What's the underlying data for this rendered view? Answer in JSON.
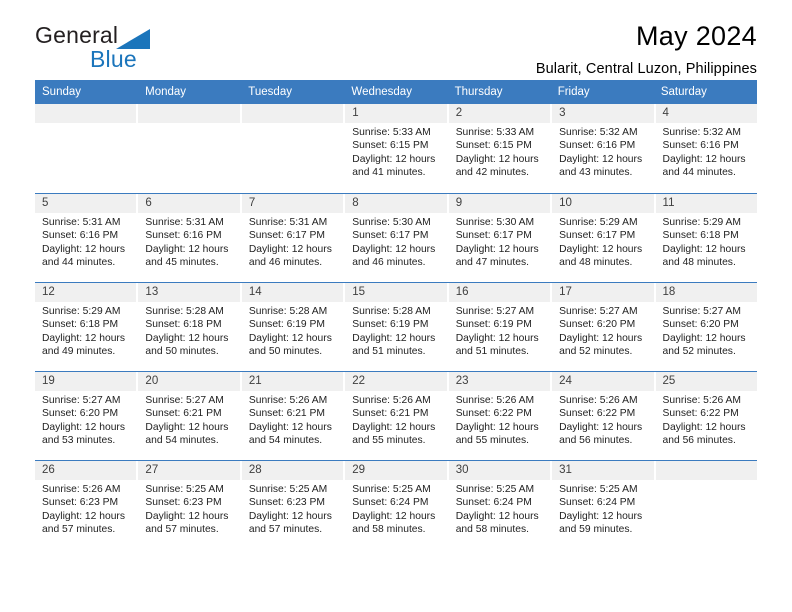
{
  "brand": {
    "name_part1": "General",
    "name_part2": "Blue",
    "triangle_color": "#1b75bb"
  },
  "header": {
    "title": "May 2024",
    "subtitle": "Bularit, Central Luzon, Philippines"
  },
  "theme": {
    "header_blue": "#3b7bbf",
    "daynum_gray": "#f0f0f0"
  },
  "calendar": {
    "weekdays": [
      "Sunday",
      "Monday",
      "Tuesday",
      "Wednesday",
      "Thursday",
      "Friday",
      "Saturday"
    ],
    "weeks": [
      [
        {
          "day": "",
          "empty": true
        },
        {
          "day": "",
          "empty": true
        },
        {
          "day": "",
          "empty": true
        },
        {
          "day": "1",
          "sunrise": "Sunrise: 5:33 AM",
          "sunset": "Sunset: 6:15 PM",
          "daylight": "Daylight: 12 hours and 41 minutes."
        },
        {
          "day": "2",
          "sunrise": "Sunrise: 5:33 AM",
          "sunset": "Sunset: 6:15 PM",
          "daylight": "Daylight: 12 hours and 42 minutes."
        },
        {
          "day": "3",
          "sunrise": "Sunrise: 5:32 AM",
          "sunset": "Sunset: 6:16 PM",
          "daylight": "Daylight: 12 hours and 43 minutes."
        },
        {
          "day": "4",
          "sunrise": "Sunrise: 5:32 AM",
          "sunset": "Sunset: 6:16 PM",
          "daylight": "Daylight: 12 hours and 44 minutes."
        }
      ],
      [
        {
          "day": "5",
          "sunrise": "Sunrise: 5:31 AM",
          "sunset": "Sunset: 6:16 PM",
          "daylight": "Daylight: 12 hours and 44 minutes."
        },
        {
          "day": "6",
          "sunrise": "Sunrise: 5:31 AM",
          "sunset": "Sunset: 6:16 PM",
          "daylight": "Daylight: 12 hours and 45 minutes."
        },
        {
          "day": "7",
          "sunrise": "Sunrise: 5:31 AM",
          "sunset": "Sunset: 6:17 PM",
          "daylight": "Daylight: 12 hours and 46 minutes."
        },
        {
          "day": "8",
          "sunrise": "Sunrise: 5:30 AM",
          "sunset": "Sunset: 6:17 PM",
          "daylight": "Daylight: 12 hours and 46 minutes."
        },
        {
          "day": "9",
          "sunrise": "Sunrise: 5:30 AM",
          "sunset": "Sunset: 6:17 PM",
          "daylight": "Daylight: 12 hours and 47 minutes."
        },
        {
          "day": "10",
          "sunrise": "Sunrise: 5:29 AM",
          "sunset": "Sunset: 6:17 PM",
          "daylight": "Daylight: 12 hours and 48 minutes."
        },
        {
          "day": "11",
          "sunrise": "Sunrise: 5:29 AM",
          "sunset": "Sunset: 6:18 PM",
          "daylight": "Daylight: 12 hours and 48 minutes."
        }
      ],
      [
        {
          "day": "12",
          "sunrise": "Sunrise: 5:29 AM",
          "sunset": "Sunset: 6:18 PM",
          "daylight": "Daylight: 12 hours and 49 minutes."
        },
        {
          "day": "13",
          "sunrise": "Sunrise: 5:28 AM",
          "sunset": "Sunset: 6:18 PM",
          "daylight": "Daylight: 12 hours and 50 minutes."
        },
        {
          "day": "14",
          "sunrise": "Sunrise: 5:28 AM",
          "sunset": "Sunset: 6:19 PM",
          "daylight": "Daylight: 12 hours and 50 minutes."
        },
        {
          "day": "15",
          "sunrise": "Sunrise: 5:28 AM",
          "sunset": "Sunset: 6:19 PM",
          "daylight": "Daylight: 12 hours and 51 minutes."
        },
        {
          "day": "16",
          "sunrise": "Sunrise: 5:27 AM",
          "sunset": "Sunset: 6:19 PM",
          "daylight": "Daylight: 12 hours and 51 minutes."
        },
        {
          "day": "17",
          "sunrise": "Sunrise: 5:27 AM",
          "sunset": "Sunset: 6:20 PM",
          "daylight": "Daylight: 12 hours and 52 minutes."
        },
        {
          "day": "18",
          "sunrise": "Sunrise: 5:27 AM",
          "sunset": "Sunset: 6:20 PM",
          "daylight": "Daylight: 12 hours and 52 minutes."
        }
      ],
      [
        {
          "day": "19",
          "sunrise": "Sunrise: 5:27 AM",
          "sunset": "Sunset: 6:20 PM",
          "daylight": "Daylight: 12 hours and 53 minutes."
        },
        {
          "day": "20",
          "sunrise": "Sunrise: 5:27 AM",
          "sunset": "Sunset: 6:21 PM",
          "daylight": "Daylight: 12 hours and 54 minutes."
        },
        {
          "day": "21",
          "sunrise": "Sunrise: 5:26 AM",
          "sunset": "Sunset: 6:21 PM",
          "daylight": "Daylight: 12 hours and 54 minutes."
        },
        {
          "day": "22",
          "sunrise": "Sunrise: 5:26 AM",
          "sunset": "Sunset: 6:21 PM",
          "daylight": "Daylight: 12 hours and 55 minutes."
        },
        {
          "day": "23",
          "sunrise": "Sunrise: 5:26 AM",
          "sunset": "Sunset: 6:22 PM",
          "daylight": "Daylight: 12 hours and 55 minutes."
        },
        {
          "day": "24",
          "sunrise": "Sunrise: 5:26 AM",
          "sunset": "Sunset: 6:22 PM",
          "daylight": "Daylight: 12 hours and 56 minutes."
        },
        {
          "day": "25",
          "sunrise": "Sunrise: 5:26 AM",
          "sunset": "Sunset: 6:22 PM",
          "daylight": "Daylight: 12 hours and 56 minutes."
        }
      ],
      [
        {
          "day": "26",
          "sunrise": "Sunrise: 5:26 AM",
          "sunset": "Sunset: 6:23 PM",
          "daylight": "Daylight: 12 hours and 57 minutes."
        },
        {
          "day": "27",
          "sunrise": "Sunrise: 5:25 AM",
          "sunset": "Sunset: 6:23 PM",
          "daylight": "Daylight: 12 hours and 57 minutes."
        },
        {
          "day": "28",
          "sunrise": "Sunrise: 5:25 AM",
          "sunset": "Sunset: 6:23 PM",
          "daylight": "Daylight: 12 hours and 57 minutes."
        },
        {
          "day": "29",
          "sunrise": "Sunrise: 5:25 AM",
          "sunset": "Sunset: 6:24 PM",
          "daylight": "Daylight: 12 hours and 58 minutes."
        },
        {
          "day": "30",
          "sunrise": "Sunrise: 5:25 AM",
          "sunset": "Sunset: 6:24 PM",
          "daylight": "Daylight: 12 hours and 58 minutes."
        },
        {
          "day": "31",
          "sunrise": "Sunrise: 5:25 AM",
          "sunset": "Sunset: 6:24 PM",
          "daylight": "Daylight: 12 hours and 59 minutes."
        },
        {
          "day": "",
          "empty": true
        }
      ]
    ]
  }
}
